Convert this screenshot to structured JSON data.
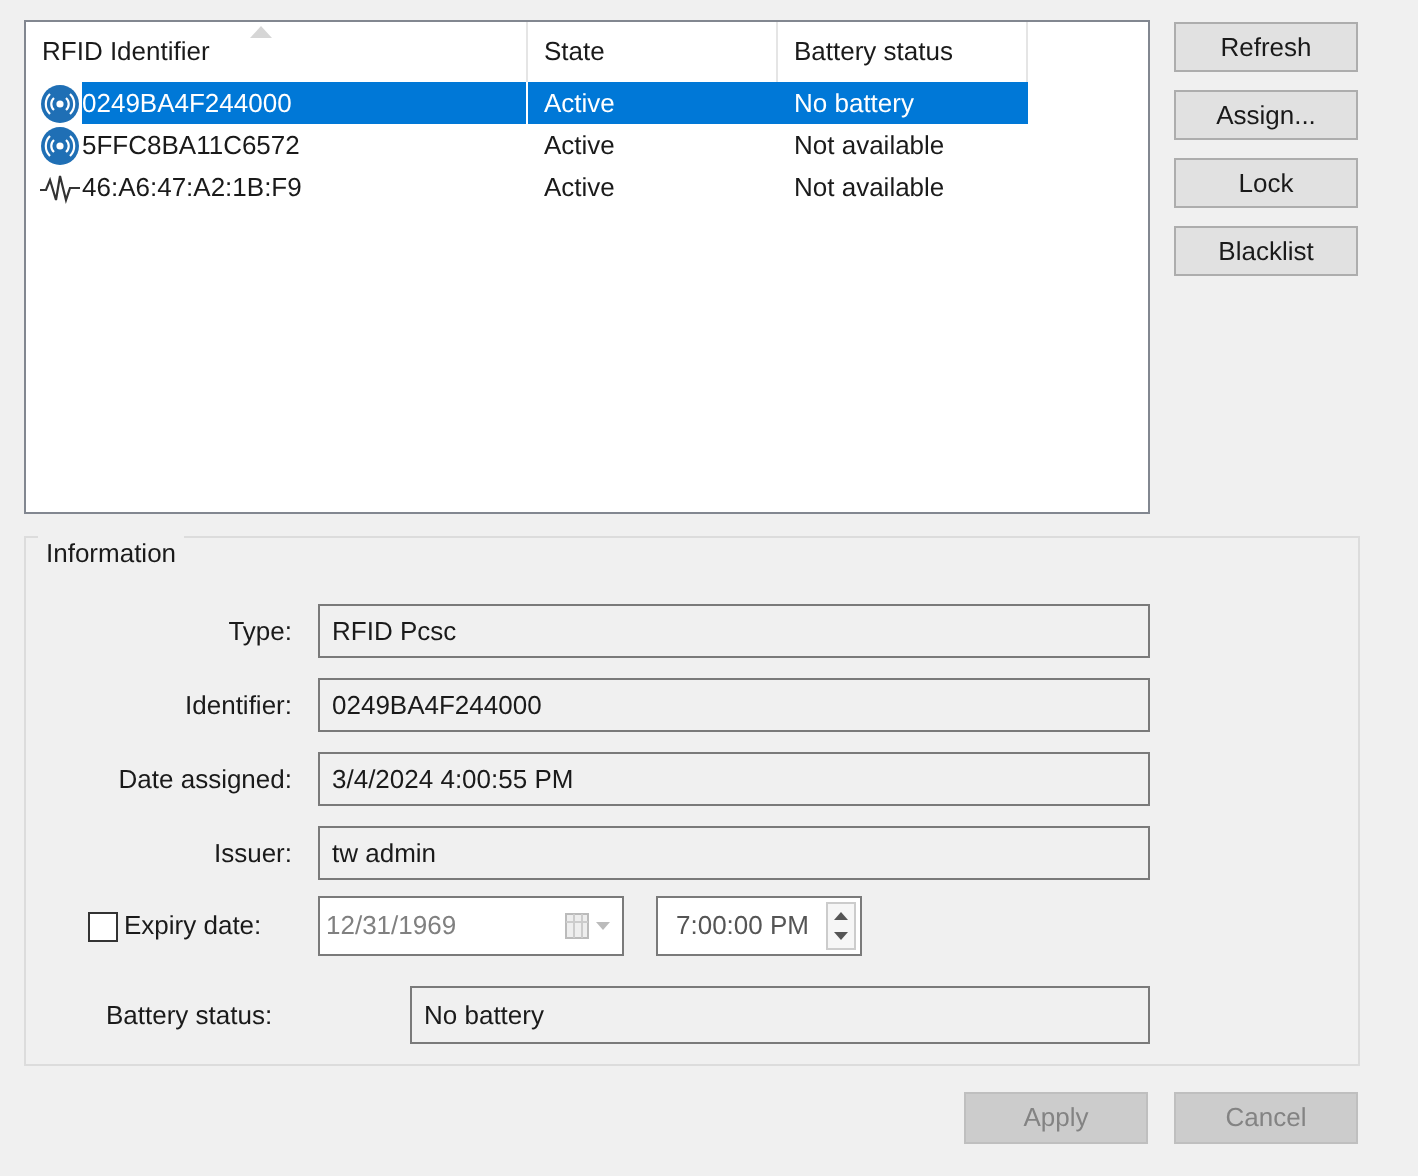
{
  "list": {
    "columns": [
      {
        "label": "RFID Identifier",
        "sorted": true
      },
      {
        "label": "State",
        "sorted": false
      },
      {
        "label": "Battery status",
        "sorted": false
      }
    ],
    "rows": [
      {
        "kind": "tag",
        "identifier": "0249BA4F244000",
        "state": "Active",
        "battery": "No battery",
        "selected": true
      },
      {
        "kind": "tag",
        "identifier": "5FFC8BA11C6572",
        "state": "Active",
        "battery": "Not available",
        "selected": false
      },
      {
        "kind": "wave",
        "identifier": "46:A6:47:A2:1B:F9",
        "state": "Active",
        "battery": "Not available",
        "selected": false
      }
    ]
  },
  "side_buttons": [
    {
      "label": "Refresh"
    },
    {
      "label": "Assign..."
    },
    {
      "label": "Lock"
    },
    {
      "label": "Blacklist"
    }
  ],
  "information": {
    "title": "Information",
    "fields": [
      {
        "label": "Type:",
        "value": "RFID Pcsc"
      },
      {
        "label": "Identifier:",
        "value": "0249BA4F244000"
      },
      {
        "label": "Date assigned:",
        "value": "3/4/2024 4:00:55 PM"
      },
      {
        "label": "Issuer:",
        "value": "tw admin"
      }
    ],
    "expiry": {
      "label": "Expiry date:",
      "checked": false,
      "date": "12/31/1969",
      "time": "7:00:00 PM"
    },
    "battery": {
      "label": "Battery status:",
      "value": "No battery"
    }
  },
  "footer_buttons": [
    {
      "label": "Apply",
      "disabled": true
    },
    {
      "label": "Cancel",
      "disabled": true
    }
  ]
}
